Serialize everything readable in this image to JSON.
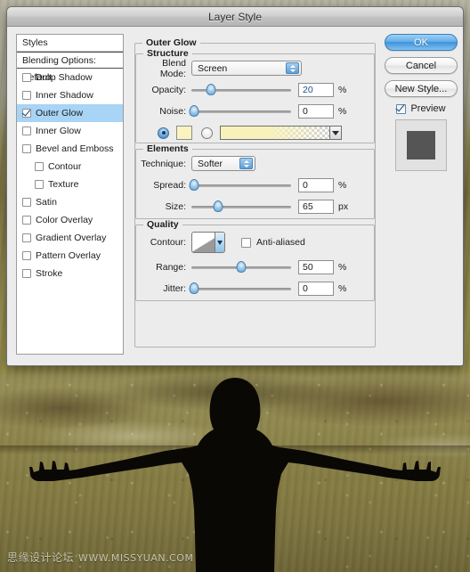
{
  "window": {
    "title": "Layer Style"
  },
  "styles_panel": {
    "header": "Styles",
    "blending_options": "Blending Options: Default",
    "items": [
      {
        "label": "Drop Shadow",
        "checked": false,
        "selected": false,
        "sub": false
      },
      {
        "label": "Inner Shadow",
        "checked": false,
        "selected": false,
        "sub": false
      },
      {
        "label": "Outer Glow",
        "checked": true,
        "selected": true,
        "sub": false
      },
      {
        "label": "Inner Glow",
        "checked": false,
        "selected": false,
        "sub": false
      },
      {
        "label": "Bevel and Emboss",
        "checked": false,
        "selected": false,
        "sub": false
      },
      {
        "label": "Contour",
        "checked": false,
        "selected": false,
        "sub": true
      },
      {
        "label": "Texture",
        "checked": false,
        "selected": false,
        "sub": true
      },
      {
        "label": "Satin",
        "checked": false,
        "selected": false,
        "sub": false
      },
      {
        "label": "Color Overlay",
        "checked": false,
        "selected": false,
        "sub": false
      },
      {
        "label": "Gradient Overlay",
        "checked": false,
        "selected": false,
        "sub": false
      },
      {
        "label": "Pattern Overlay",
        "checked": false,
        "selected": false,
        "sub": false
      },
      {
        "label": "Stroke",
        "checked": false,
        "selected": false,
        "sub": false
      }
    ]
  },
  "main": {
    "group_title": "Outer Glow",
    "structure": {
      "title": "Structure",
      "blend_mode_label": "Blend Mode:",
      "blend_mode_value": "Screen",
      "opacity_label": "Opacity:",
      "opacity_value": "20",
      "opacity_unit": "%",
      "opacity_percent": 20,
      "noise_label": "Noise:",
      "noise_value": "0",
      "noise_unit": "%",
      "noise_percent": 0,
      "fill_type": "color",
      "color_hex": "#faf3c0",
      "gradient_from_hex": "#f8f2ba",
      "gradient_to": "transparent"
    },
    "elements": {
      "title": "Elements",
      "technique_label": "Technique:",
      "technique_value": "Softer",
      "spread_label": "Spread:",
      "spread_value": "0",
      "spread_unit": "%",
      "spread_percent": 0,
      "size_label": "Size:",
      "size_value": "65",
      "size_unit": "px",
      "size_percent": 27
    },
    "quality": {
      "title": "Quality",
      "contour_label": "Contour:",
      "anti_aliased_label": "Anti-aliased",
      "anti_aliased_checked": false,
      "range_label": "Range:",
      "range_value": "50",
      "range_unit": "%",
      "range_percent": 50,
      "jitter_label": "Jitter:",
      "jitter_value": "0",
      "jitter_unit": "%",
      "jitter_percent": 0
    }
  },
  "buttons": {
    "ok": "OK",
    "cancel": "Cancel",
    "new_style": "New Style...",
    "preview_label": "Preview",
    "preview_checked": true
  },
  "watermark": {
    "cn_text": "思缘设计论坛",
    "url_text": "WWW.MISSYUAN.COM"
  },
  "colors": {
    "accent_blue": "#3f92da",
    "selection_blue": "#a8d4f5",
    "dialog_bg": "#ececec",
    "glow_yellow": "#faf3c0"
  }
}
